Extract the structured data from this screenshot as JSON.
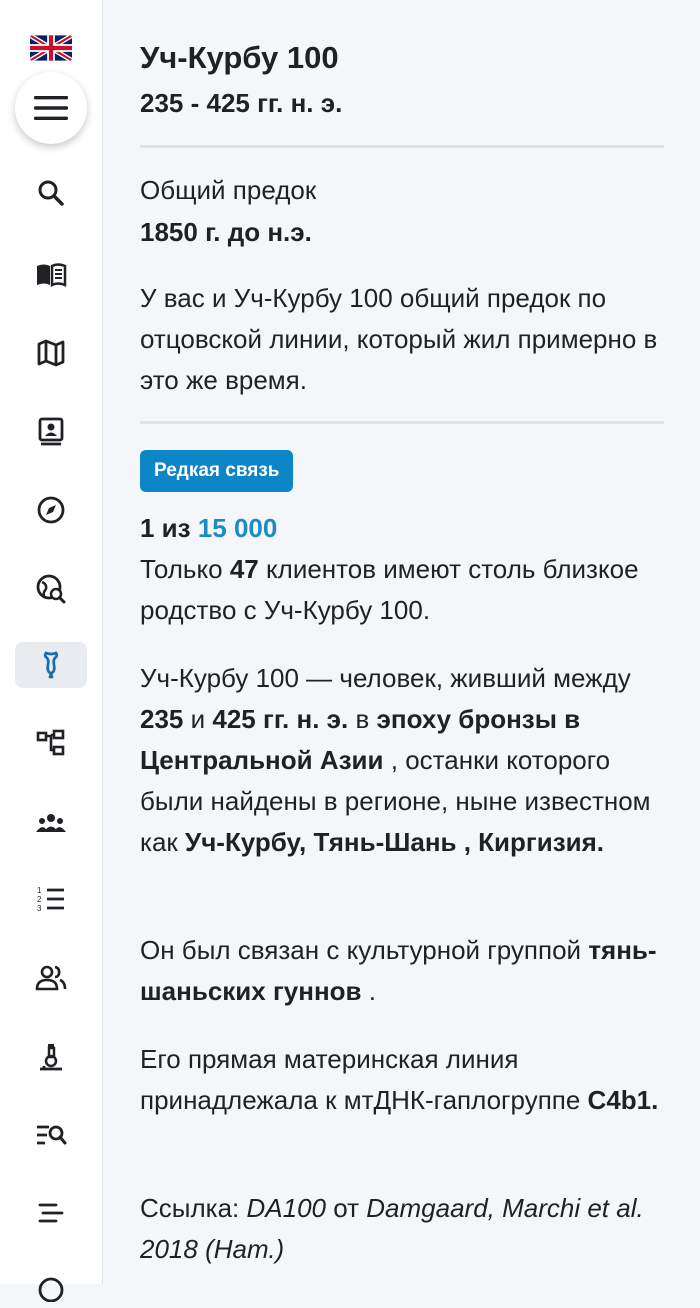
{
  "sidebar": {
    "language_flag": "uk-flag-icon",
    "menu_icon": "hamburger-menu-icon",
    "items": [
      {
        "icon": "search-icon"
      },
      {
        "icon": "book-icon"
      },
      {
        "icon": "map-icon"
      },
      {
        "icon": "profile-card-icon"
      },
      {
        "icon": "compass-icon"
      },
      {
        "icon": "globe-search-icon"
      },
      {
        "icon": "dna-bone-icon",
        "active": true
      },
      {
        "icon": "tree-icon"
      },
      {
        "icon": "group-icon"
      },
      {
        "icon": "ordered-list-icon"
      },
      {
        "icon": "people-icon"
      },
      {
        "icon": "microscope-icon"
      },
      {
        "icon": "list-search-icon"
      },
      {
        "icon": "sort-lines-icon"
      }
    ]
  },
  "header": {
    "title": "Уч-Курбу 100",
    "dates": "235 - 425 гг. н. э."
  },
  "ancestor": {
    "label": "Общий предок",
    "date": "1850 г. до н.э.",
    "description": "У вас и Уч-Курбу 100 общий предок по отцовской линии, который жил примерно в это же время."
  },
  "rarity": {
    "badge": "Редкая связь",
    "prefix": "1 из",
    "value": "15 000",
    "clients_text_before": "Только",
    "clients_count": "47",
    "clients_text_after": "клиентов имеют столь близкое родство с Уч-Курбу 100."
  },
  "bio": {
    "p1_a": "Уч-Курбу 100 — человек, живший между",
    "p1_from": "235",
    "p1_and": "и",
    "p1_to": "425 гг. н. э.",
    "p1_in": "в",
    "p1_era": "эпоху бронзы в Центральной Азии",
    "p1_b": ", останки которого были найдены в регионе, ныне известном как",
    "p1_place": "Уч-Курбу, Тянь-Шань , Киргизия.",
    "p2_a": "Он был связан с культурной группой",
    "p2_group": "тянь-шаньских гуннов",
    "p2_end": ".",
    "p3_a": "Его прямая материнская линия принадлежала к мтДНК-гаплогруппе",
    "p3_haplo": "C4b1.",
    "ref_label": "Ссылка:",
    "ref_id": "DA100",
    "ref_from": "от",
    "ref_source": "Damgaard, Marchi et al. 2018 (Нат.)"
  },
  "colors": {
    "accent": "#1a8cc4",
    "badge_bg": "#0d86c7",
    "background": "#f4f6f9"
  }
}
